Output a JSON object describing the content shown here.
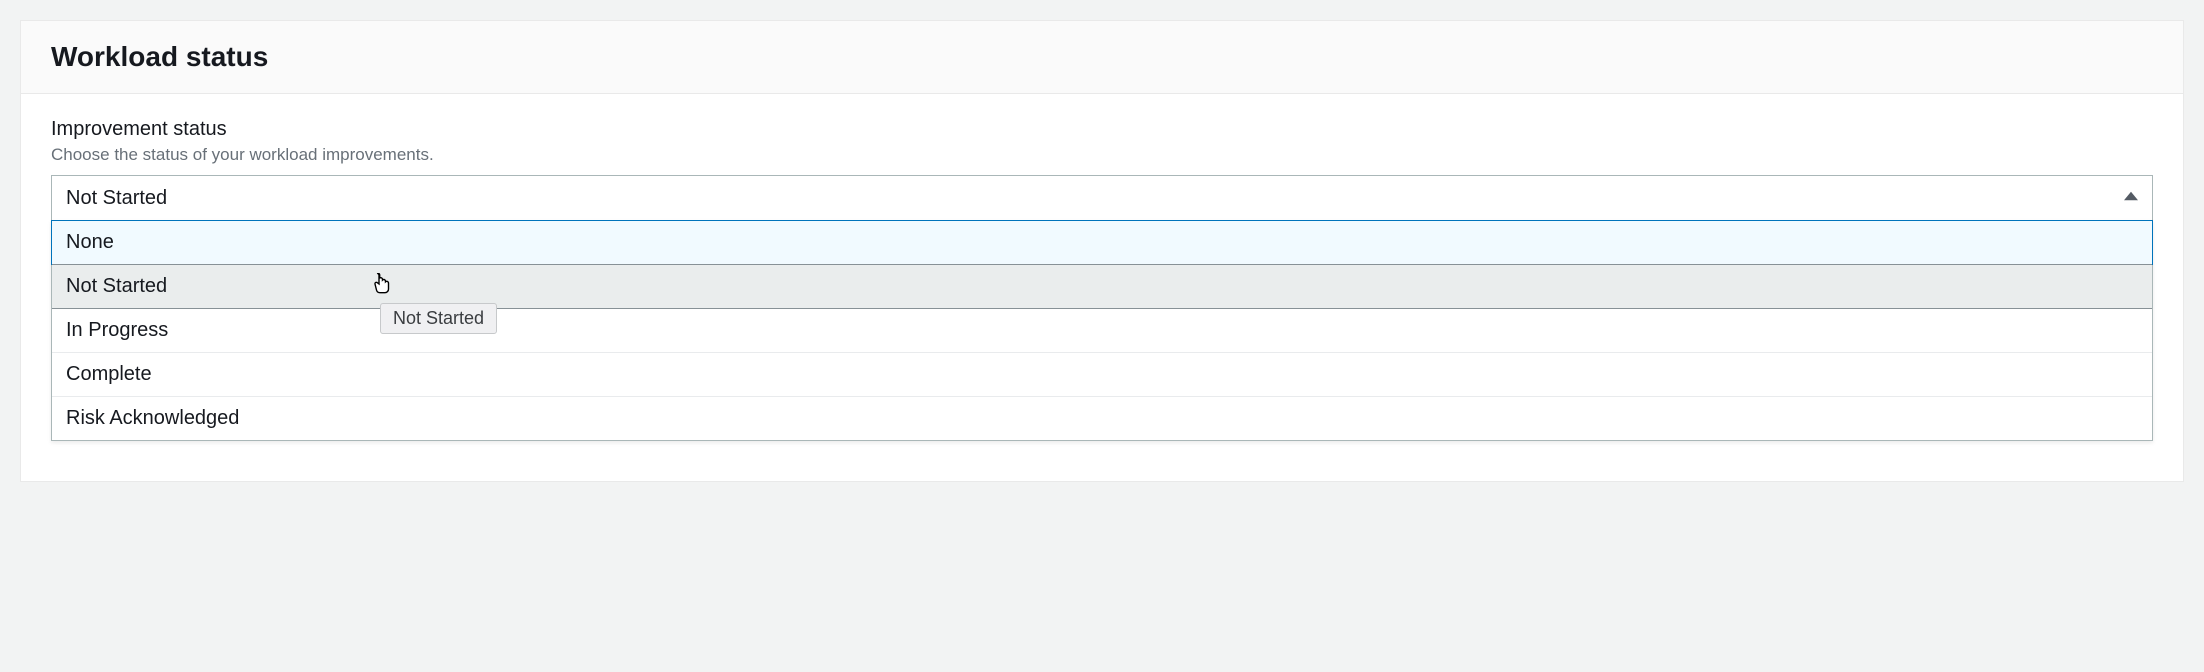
{
  "panel": {
    "title": "Workload status"
  },
  "field": {
    "label": "Improvement status",
    "hint": "Choose the status of your workload improvements.",
    "selected_value": "Not Started"
  },
  "options": {
    "0": "None",
    "1": "Not Started",
    "2": "In Progress",
    "3": "Complete",
    "4": "Risk Acknowledged"
  },
  "tooltip": {
    "text": "Not Started"
  }
}
